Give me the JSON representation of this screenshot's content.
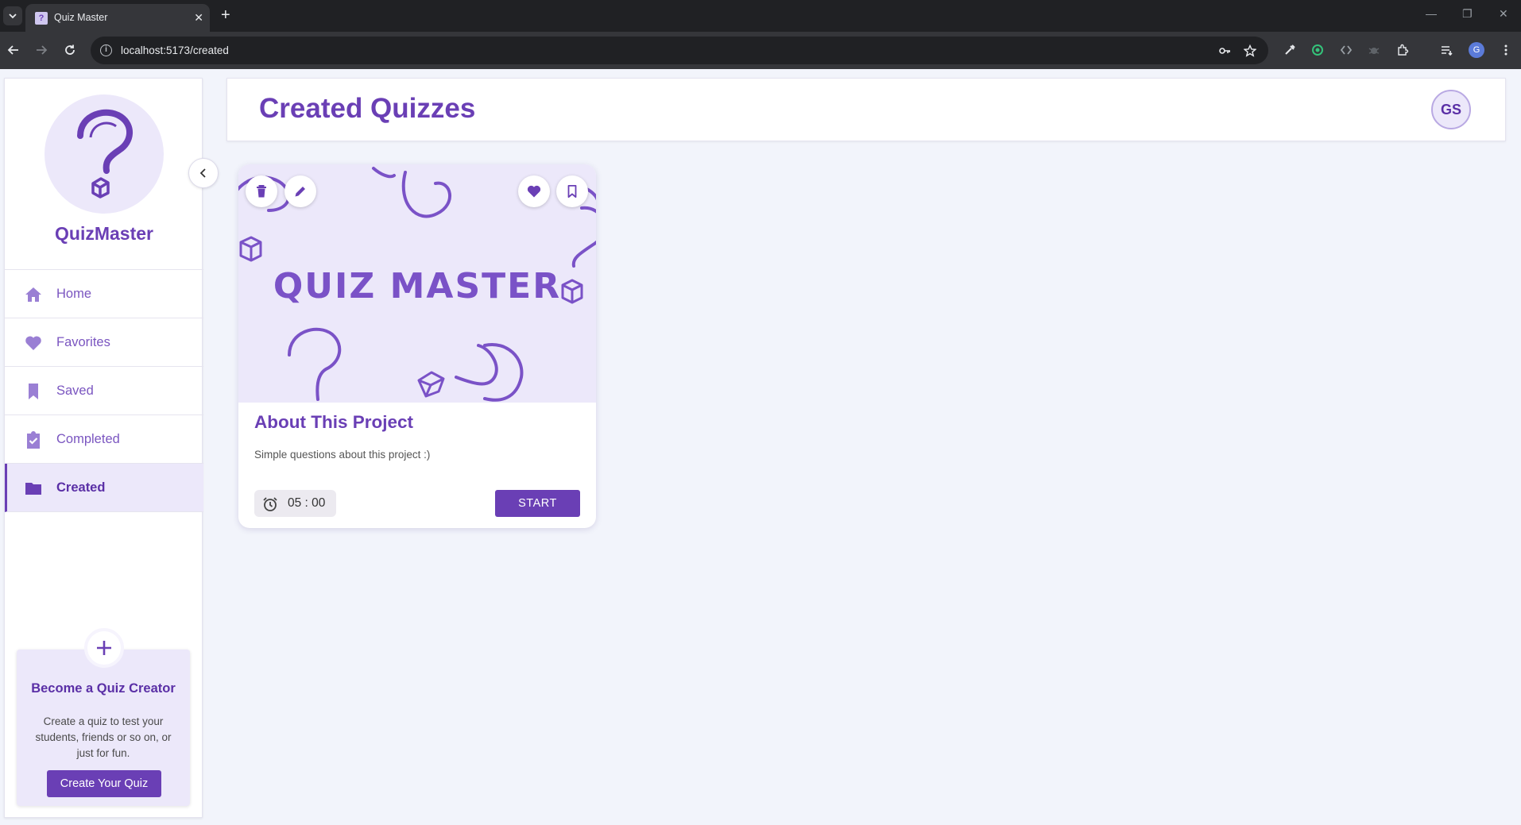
{
  "browser": {
    "tab_title": "Quiz Master",
    "url": "localhost:5173/created",
    "profile_initial": "G"
  },
  "app": {
    "name": "QuizMaster",
    "accent_color": "#6a3fb5",
    "accent_light": "#ece8fa"
  },
  "sidebar": {
    "items": [
      {
        "label": "Home",
        "icon": "home-icon",
        "active": false
      },
      {
        "label": "Favorites",
        "icon": "heart-icon",
        "active": false
      },
      {
        "label": "Saved",
        "icon": "bookmark-icon",
        "active": false
      },
      {
        "label": "Completed",
        "icon": "clipboard-check-icon",
        "active": false
      },
      {
        "label": "Created",
        "icon": "folder-icon",
        "active": true
      }
    ],
    "creator": {
      "title": "Become a Quiz Creator",
      "description": "Create a quiz to test your students, friends or so on, or just for fun.",
      "button_label": "Create Your Quiz"
    }
  },
  "header": {
    "title": "Created Quizzes",
    "user_initials": "GS"
  },
  "quizzes": [
    {
      "banner_text": "QUIZ MASTER",
      "title": "About This Project",
      "description": "Simple questions about this project :)",
      "timer": "05 : 00",
      "start_label": "START"
    }
  ]
}
